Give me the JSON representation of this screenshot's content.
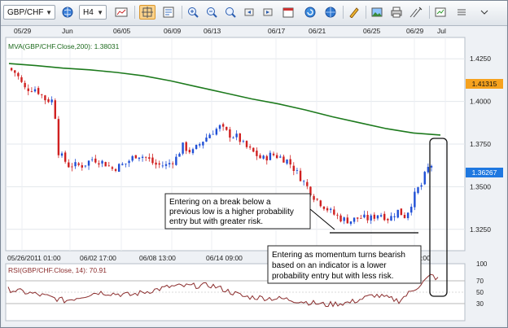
{
  "toolbar": {
    "symbol": "GBP/CHF",
    "timeframe": "H4",
    "icons": [
      "globe-icon",
      "bar-chart-type-icon",
      "crosshair-icon",
      "data-window-icon",
      "zoom-in-icon",
      "zoom-out-icon",
      "zoom-fit-icon",
      "scroll-left-icon",
      "scroll-right-icon",
      "calendar-icon",
      "refresh-icon",
      "pencil-icon",
      "save-image-icon",
      "print-icon",
      "draw-tools-icon",
      "indicators-icon",
      "more-icon"
    ]
  },
  "chart": {
    "date_labels_top": [
      "05/29",
      "Jun",
      "06/05",
      "06/09",
      "06/13",
      "06/17",
      "06/21",
      "06/25",
      "06/29",
      "Jul"
    ],
    "date_labels_bottom": [
      "05/26/2011 01:00",
      "06/02 17:00",
      "06/08 13:00",
      "06/14 09:00"
    ],
    "bottom_truncated": ":00",
    "price_ticks": [
      "1.4250",
      "1.4000",
      "1.3750",
      "1.3500",
      "1.3250"
    ],
    "rsi_ticks": [
      "100",
      "70",
      "50",
      "30"
    ],
    "mva_label": "MVA(GBP/CHF.Close,200): 1.38031",
    "rsi_label": "RSI(GBP/CHF.Close, 14): 70.91",
    "mva_tag": "1.41315",
    "price_tag": "1.36267",
    "annotation_1": [
      "Entering on a break below a",
      "previous low is a higher probability",
      "entry but with greater risk."
    ],
    "annotation_2": [
      "Entering as momentum turns bearish",
      "based on an indicator is a lower",
      "probability entry but with less risk."
    ],
    "colors": {
      "up": "#1f4fd6",
      "down": "#d02020",
      "mva": "#1d7a1d",
      "rsi": "#8b2d2d",
      "mva_tag": "#f6a21e",
      "price_tag": "#1f78e0"
    }
  },
  "chart_data": {
    "type": "candlestick",
    "y_range": [
      1.3125,
      1.4375
    ],
    "mva": [
      1.4222,
      1.421,
      1.4195,
      1.4185,
      1.417,
      1.415,
      1.412,
      1.4085,
      1.405,
      1.4015,
      1.3985,
      1.395,
      1.391,
      1.3875,
      1.384,
      1.3815,
      1.3803
    ],
    "rsi_range": [
      0,
      100
    ],
    "rsi_last": 70.91
  }
}
